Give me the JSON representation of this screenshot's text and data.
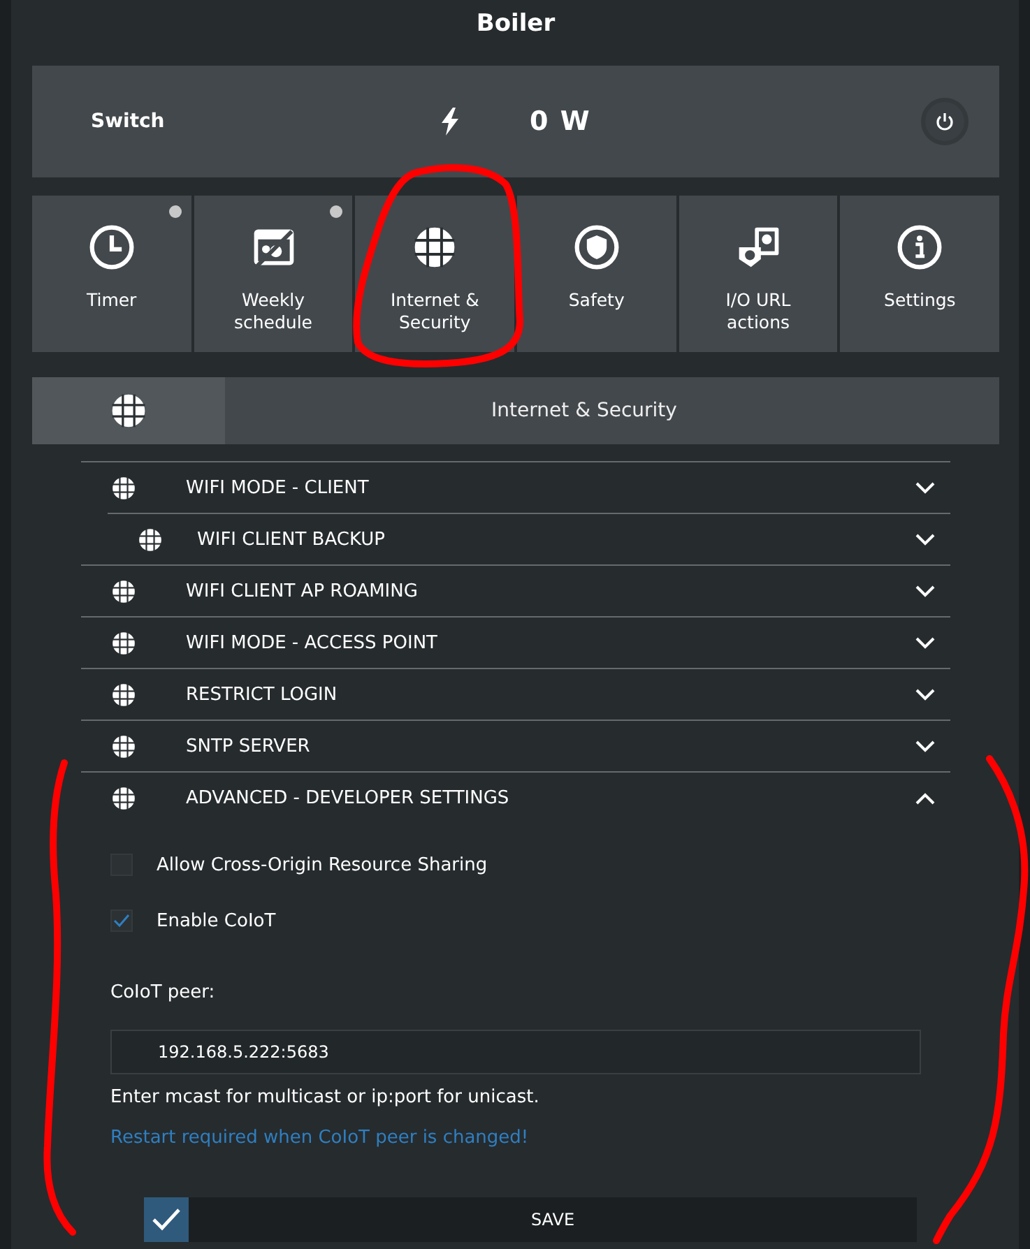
{
  "title": "Boiler",
  "switch": {
    "label": "Switch",
    "reading": "0 W",
    "on": false
  },
  "tiles": [
    {
      "kind": "clock",
      "label": "Timer",
      "indicator": true
    },
    {
      "kind": "schedule",
      "label": "Weekly schedule",
      "indicator": true
    },
    {
      "kind": "globe",
      "label": "Internet & Security",
      "indicator": false
    },
    {
      "kind": "shield",
      "label": "Safety",
      "indicator": false
    },
    {
      "kind": "io",
      "label": "I/O URL actions",
      "indicator": false
    },
    {
      "kind": "info",
      "label": "Settings",
      "indicator": false
    }
  ],
  "section": {
    "title": "Internet & Security"
  },
  "accordion": [
    {
      "label": "WIFI MODE - CLIENT",
      "expanded": false,
      "children": [
        {
          "label": "WIFI CLIENT BACKUP",
          "expanded": false
        }
      ]
    },
    {
      "label": "WIFI CLIENT AP ROAMING",
      "expanded": false
    },
    {
      "label": "WIFI MODE - ACCESS POINT",
      "expanded": false
    },
    {
      "label": "RESTRICT LOGIN",
      "expanded": false
    },
    {
      "label": "SNTP SERVER",
      "expanded": false
    },
    {
      "label": "ADVANCED - DEVELOPER SETTINGS",
      "expanded": true,
      "content": {
        "checkboxes": [
          {
            "label": "Allow Cross-Origin Resource Sharing",
            "checked": false
          },
          {
            "label": "Enable CoIoT",
            "checked": true
          }
        ],
        "field": {
          "label": "CoIoT peer:",
          "value": "192.168.5.222:5683"
        },
        "hint": "Enter mcast for multicast or ip:port for unicast.",
        "note": "Restart required when CoIoT peer is changed!",
        "save": "SAVE"
      }
    }
  ]
}
